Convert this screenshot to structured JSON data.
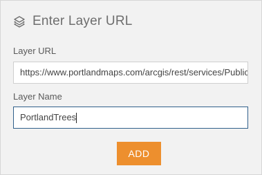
{
  "header": {
    "icon": "layers-icon",
    "title": "Enter Layer URL"
  },
  "layer_url": {
    "label": "Layer URL",
    "value": "https://www.portlandmaps.com/arcgis/rest/services/Public"
  },
  "layer_name": {
    "label": "Layer Name",
    "value": "PortlandTrees"
  },
  "add_button": {
    "label": "ADD"
  },
  "colors": {
    "accent": "#ed8f2e",
    "focus_border": "#2f5f8a",
    "panel_bg": "#f2f2f2"
  }
}
